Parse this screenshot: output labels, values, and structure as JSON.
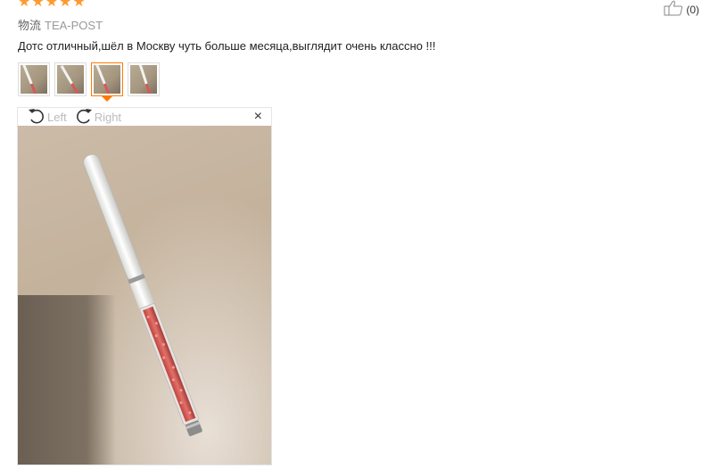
{
  "review": {
    "rating_stars": 5,
    "shipping_label": "物流",
    "shipping_value": "TEA-POST",
    "text": "Дотс отличный,шёл в Москву чуть больше месяца,выглядит очень классно !!!",
    "helpful_count": "(0)"
  },
  "thumbnails": {
    "count": 4,
    "active_index": 2
  },
  "viewer": {
    "rotate_left_label": "Left",
    "rotate_right_label": "Right",
    "close_icon": "×"
  },
  "colors": {
    "star": "#ff9a2e",
    "active_thumb_border": "#ff7a00"
  },
  "icons": {
    "helpful": "thumbs-up-icon",
    "rotate_left": "rotate-left-icon",
    "rotate_right": "rotate-right-icon",
    "close": "close-icon"
  }
}
